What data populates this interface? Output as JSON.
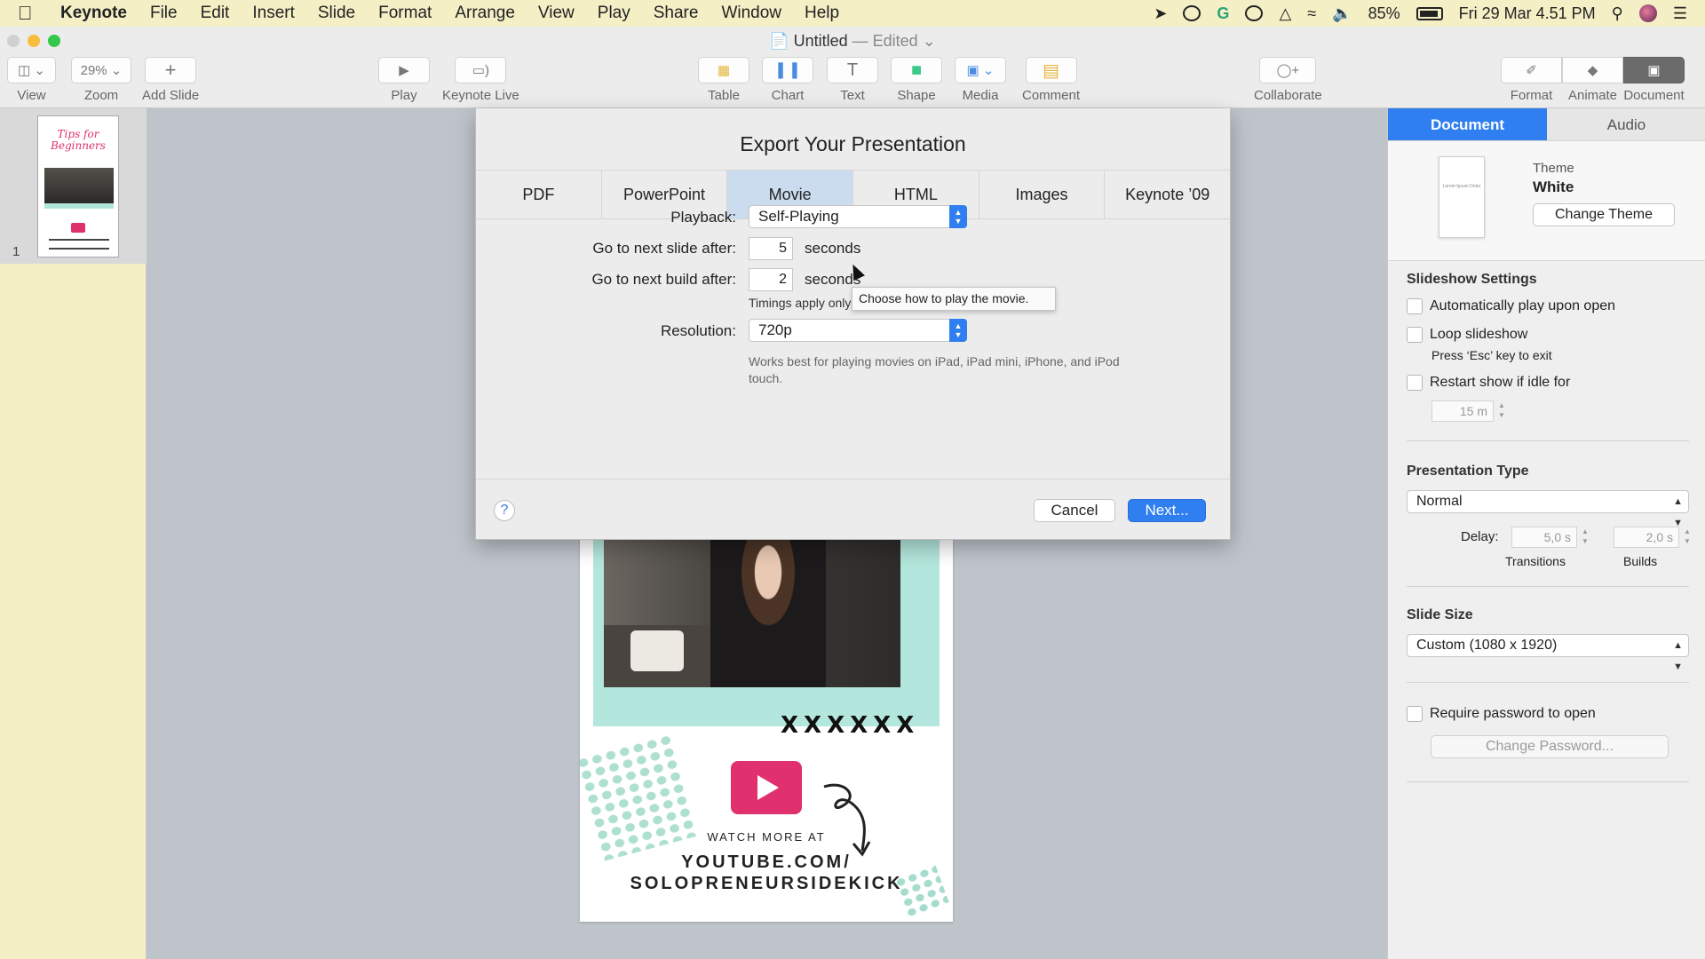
{
  "menubar": {
    "app_name": "Keynote",
    "items": [
      "File",
      "Edit",
      "Insert",
      "Slide",
      "Format",
      "Arrange",
      "View",
      "Play",
      "Share",
      "Window",
      "Help"
    ],
    "battery": "85%",
    "datetime": "Fri 29 Mar  4.51 PM"
  },
  "window": {
    "title": "Untitled",
    "title_suffix": "— Edited"
  },
  "toolbar": {
    "view_label": "View",
    "zoom_value": "29%",
    "zoom_label": "Zoom",
    "add_slide_label": "Add Slide",
    "play_label": "Play",
    "keynote_live_label": "Keynote Live",
    "table_label": "Table",
    "chart_label": "Chart",
    "text_label": "Text",
    "shape_label": "Shape",
    "media_label": "Media",
    "comment_label": "Comment",
    "collaborate_label": "Collaborate",
    "format_label": "Format",
    "animate_label": "Animate",
    "document_label": "Document"
  },
  "navigator": {
    "slide_number": "1"
  },
  "slide": {
    "watch_text": "WATCH MORE AT",
    "url_line1": "YOUTUBE.COM/",
    "url_line2": "SOLOPRENEURSIDEKICK",
    "x_marks": "XXXXXX"
  },
  "export_dialog": {
    "title": "Export Your Presentation",
    "tabs": [
      {
        "label": "PDF",
        "active": false
      },
      {
        "label": "PowerPoint",
        "active": false
      },
      {
        "label": "Movie",
        "active": true
      },
      {
        "label": "HTML",
        "active": false
      },
      {
        "label": "Images",
        "active": false
      },
      {
        "label": "Keynote ’09",
        "active": false
      }
    ],
    "playback_label": "Playback:",
    "playback_value": "Self-Playing",
    "next_slide_label": "Go to next slide after:",
    "next_slide_value": "5",
    "next_slide_unit": "seconds",
    "next_build_label": "Go to next build after:",
    "next_build_value": "2",
    "next_build_unit": "seconds",
    "timings_hint": "Timings apply only to click events.",
    "resolution_label": "Resolution:",
    "resolution_value": "720p",
    "resolution_hint": "Works best for playing movies on iPad, iPad mini, iPhone, and iPod touch.",
    "tooltip": "Choose how to play the movie.",
    "help_label": "?",
    "cancel_label": "Cancel",
    "next_label": "Next..."
  },
  "inspector": {
    "tabs": [
      {
        "label": "Document",
        "active": true
      },
      {
        "label": "Audio",
        "active": false
      }
    ],
    "theme_thumb_text": "Lorem Ipsum Dolor",
    "theme_label": "Theme",
    "theme_name": "White",
    "change_theme_label": "Change Theme",
    "slideshow_heading": "Slideshow Settings",
    "auto_play_label": "Automatically play upon open",
    "loop_label": "Loop slideshow",
    "loop_hint": "Press ‘Esc’ key to exit",
    "restart_label": "Restart show if idle for",
    "idle_value": "15 m",
    "presentation_type_heading": "Presentation Type",
    "presentation_type_value": "Normal",
    "delay_label": "Delay:",
    "transitions_value": "5,0 s",
    "builds_value": "2,0 s",
    "transitions_label": "Transitions",
    "builds_label": "Builds",
    "slide_size_heading": "Slide Size",
    "slide_size_value": "Custom (1080 x 1920)",
    "require_password_label": "Require password to open",
    "change_password_label": "Change Password..."
  },
  "colors": {
    "accent_blue": "#2f7ff0",
    "menubar_bg": "#f5efc6",
    "brand_pink": "#e0306d",
    "mint": "#b3e6dc"
  }
}
